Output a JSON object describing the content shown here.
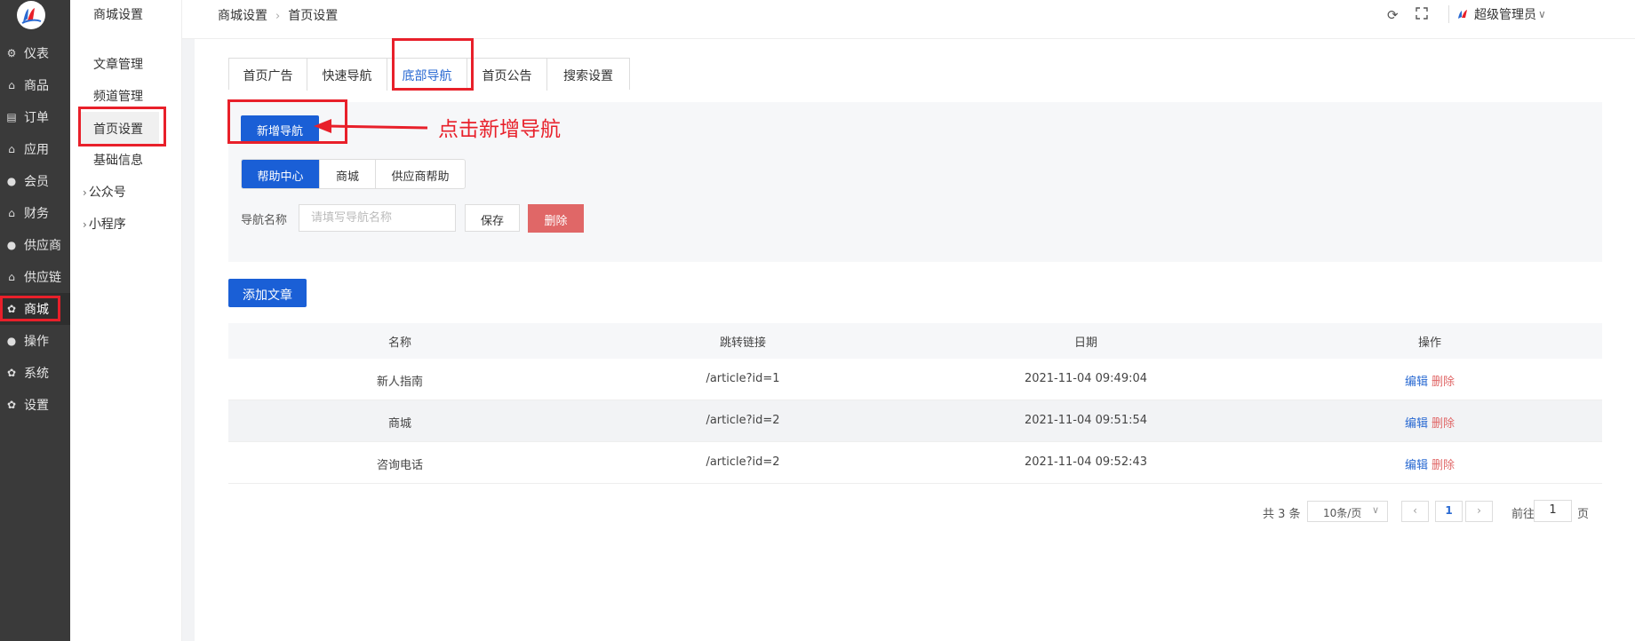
{
  "rail": {
    "items": [
      {
        "label": "仪表",
        "icon": "dashboard-icon",
        "glyph": "⚙"
      },
      {
        "label": "商品",
        "icon": "bag-icon",
        "glyph": "⌂"
      },
      {
        "label": "订单",
        "icon": "clipboard-icon",
        "glyph": "▤"
      },
      {
        "label": "应用",
        "icon": "bag-icon",
        "glyph": "⌂"
      },
      {
        "label": "会员",
        "icon": "user-icon",
        "glyph": "●"
      },
      {
        "label": "财务",
        "icon": "bag-icon",
        "glyph": "⌂"
      },
      {
        "label": "供应商",
        "icon": "user-icon",
        "glyph": "●"
      },
      {
        "label": "供应链",
        "icon": "bag-icon",
        "glyph": "⌂"
      },
      {
        "label": "商城",
        "icon": "gear-icon",
        "glyph": "✿"
      },
      {
        "label": "操作",
        "icon": "user-icon",
        "glyph": "●"
      },
      {
        "label": "系统",
        "icon": "gear-icon",
        "glyph": "✿"
      },
      {
        "label": "设置",
        "icon": "gear-icon",
        "glyph": "✿"
      }
    ],
    "active_index": 8
  },
  "submenu": {
    "title": "商城设置",
    "items": [
      "文章管理",
      "频道管理",
      "首页设置",
      "基础信息"
    ],
    "groups": [
      "公众号",
      "小程序"
    ]
  },
  "header": {
    "breadcrumb": [
      "商城设置",
      "首页设置"
    ],
    "username": "超级管理员"
  },
  "tabs": [
    "首页广告",
    "快速导航",
    "底部导航",
    "首页公告",
    "搜索设置"
  ],
  "active_tab": 2,
  "nav_panel": {
    "add_nav_label": "新增导航",
    "segments": [
      "帮助中心",
      "商城",
      "供应商帮助"
    ],
    "name_label": "导航名称",
    "name_placeholder": "请填写导航名称",
    "name_value": "",
    "save_label": "保存",
    "delete_label": "删除"
  },
  "annotation": {
    "text": "点击新增导航",
    "color": "#e8202a"
  },
  "add_article_label": "添加文章",
  "table": {
    "columns": [
      "名称",
      "跳转链接",
      "日期",
      "操作"
    ],
    "rows": [
      {
        "name": "新人指南",
        "link": "/article?id=1",
        "date": "2021-11-04 09:49:04",
        "edit": "编辑",
        "delete": "删除"
      },
      {
        "name": "商城",
        "link": "/article?id=2",
        "date": "2021-11-04 09:51:54",
        "edit": "编辑",
        "delete": "删除"
      },
      {
        "name": "咨询电话",
        "link": "/article?id=2",
        "date": "2021-11-04 09:52:43",
        "edit": "编辑",
        "delete": "删除"
      }
    ]
  },
  "pagination": {
    "total_text": "共 3 条",
    "page_size": "10条/页",
    "current_page": "1",
    "goto_label": "前往",
    "goto_value": "1",
    "page_suffix": "页"
  },
  "colors": {
    "primary": "#1a5fd6",
    "danger": "#e06767",
    "rail_bg": "#3a3a3a",
    "annotation": "#e8202a"
  }
}
